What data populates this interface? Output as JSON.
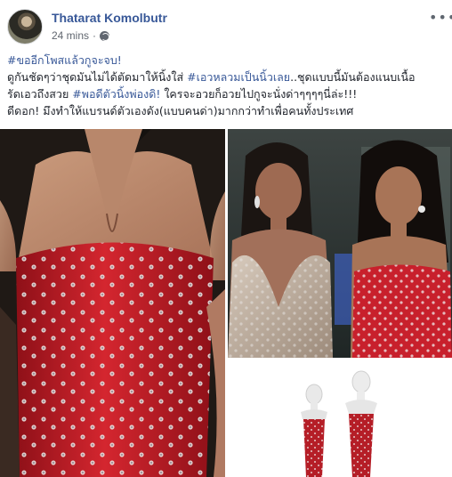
{
  "post": {
    "author": "Thatarat Komolbutr",
    "time": "24 mins",
    "privacy_icon": "globe-icon",
    "more_icon": "more-options-icon",
    "text_lines": [
      [
        {
          "t": "#ขออีกโพสแล้วกูจะจบ!",
          "tag": true
        }
      ],
      [
        {
          "t": "ดูกันชัดๆว่าชุดมันไม่ได้ตัดมาให้นิ้งใส่ ",
          "tag": false
        },
        {
          "t": "#เอวหลวมเป็นนิ้วเลย",
          "tag": true
        },
        {
          "t": "..ชุดแบบนี้มันต้องแนบเนื้อ",
          "tag": false
        }
      ],
      [
        {
          "t": "รัดเอวถึงสวย ",
          "tag": false
        },
        {
          "t": "#พอดีตัวนิ้งพ่องดิ!",
          "tag": true
        },
        {
          "t": " ใครจะอวยก็อวยไปกูจะนั่งด่าๆๆๆๆนี่ล่ะ!!!",
          "tag": false
        }
      ],
      [
        {
          "t": "ดีดอก! มึงทำให้แบรนด์ตัวเองดัง(แบบคนด่า)มากกว่าทำเพื่อคนทั้งประเทศ",
          "tag": false
        }
      ]
    ],
    "colors": {
      "link": "#385898",
      "dress_red": "#c8202c",
      "gown_silver": "#b9a898"
    }
  }
}
